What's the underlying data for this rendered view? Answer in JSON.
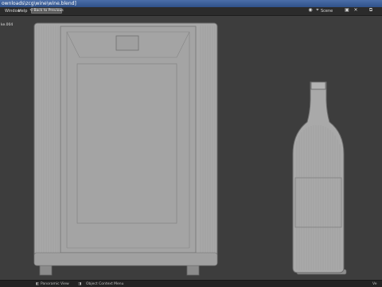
{
  "titlebar": {
    "title": "ownloads\\zcg\\wine\\wine.blend]"
  },
  "menu": {
    "window_label": "Window",
    "help_label": "Help",
    "back_to_previous_label": "Back to Previous"
  },
  "header": {
    "scene_label": "Scene"
  },
  "viewport": {
    "view_label": "ke.004"
  },
  "statusbar": {
    "pan_view_label": "Panoramic View",
    "context_menu_label": "Object Context Menu",
    "right_text": "Ve"
  },
  "icons": {
    "back": "back-arrow-icon",
    "scene": "scene-icon",
    "status_mouse_left": "mouse-left-icon",
    "status_mouse_right": "mouse-right-icon",
    "top_right_1": "render-icon",
    "top_right_2": "new-scene-icon",
    "top_right_3": "remove-scene-icon",
    "top_right_4": "view-layer-icon"
  }
}
